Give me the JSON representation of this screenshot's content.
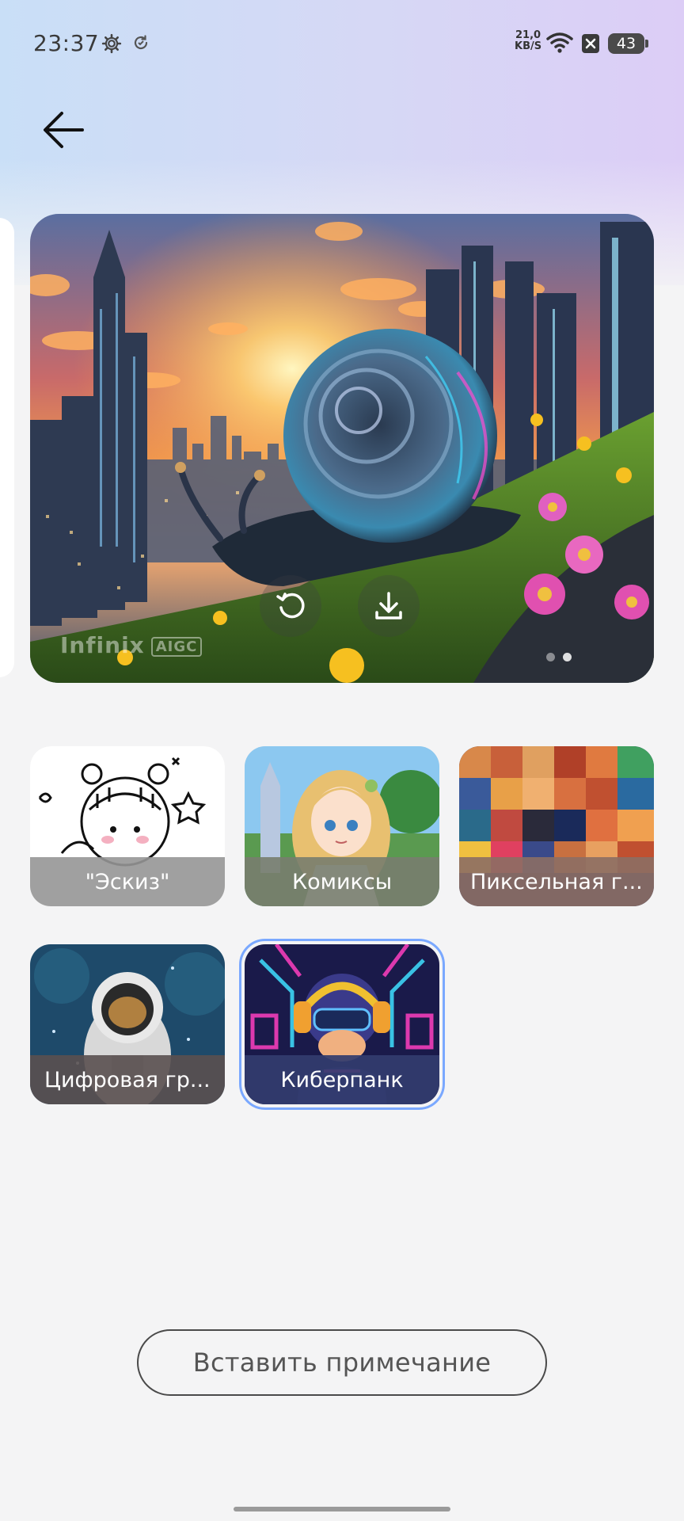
{
  "status_bar": {
    "time": "23:37",
    "net_speed_value": "21,0",
    "net_speed_unit": "KB/S",
    "battery": "43",
    "icons": [
      "gear-icon",
      "sync-icon",
      "wifi-icon",
      "close-box-icon",
      "battery-icon"
    ]
  },
  "header": {
    "back_icon": "arrow-left-icon"
  },
  "preview": {
    "watermark": "Infinix",
    "watermark_badge": "AIGC",
    "actions": [
      {
        "name": "regenerate",
        "icon": "refresh-icon"
      },
      {
        "name": "download",
        "icon": "download-icon"
      }
    ],
    "page_count": 2,
    "active_page": 1
  },
  "styles": [
    {
      "label": "\"Эскиз\"",
      "selected": false,
      "art": "sketch"
    },
    {
      "label": "Комиксы",
      "selected": false,
      "art": "comics"
    },
    {
      "label": "Пиксельная г...",
      "selected": false,
      "art": "pixel"
    },
    {
      "label": "Цифровая гр...",
      "selected": false,
      "art": "digital"
    },
    {
      "label": "Киберпанк",
      "selected": true,
      "art": "cyberpunk"
    }
  ],
  "insert_button": {
    "label": "Вставить примечание"
  },
  "colors": {
    "accent_selected": "#7aa8ff",
    "background": "#f4f4f5"
  }
}
